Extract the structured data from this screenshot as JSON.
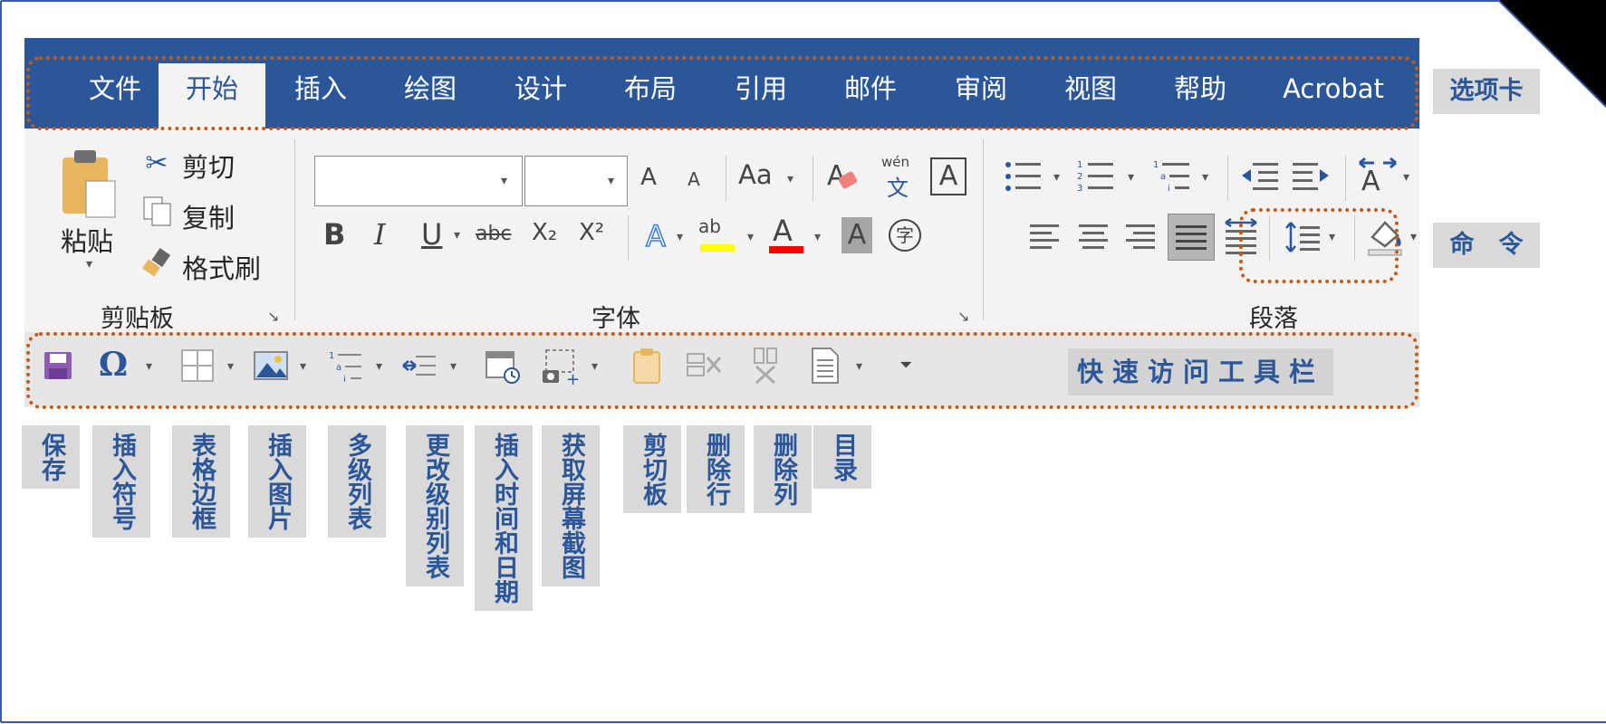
{
  "tabs": [
    {
      "label": "文件"
    },
    {
      "label": "开始"
    },
    {
      "label": "插入"
    },
    {
      "label": "绘图"
    },
    {
      "label": "设计"
    },
    {
      "label": "布局"
    },
    {
      "label": "引用"
    },
    {
      "label": "邮件"
    },
    {
      "label": "审阅"
    },
    {
      "label": "视图"
    },
    {
      "label": "帮助"
    },
    {
      "label": "Acrobat"
    }
  ],
  "clipboard": {
    "paste": "粘贴",
    "cut": "剪切",
    "copy": "复制",
    "format_painter": "格式刷",
    "group": "剪贴板"
  },
  "font": {
    "group": "字体",
    "change_case": "Aa",
    "phonetic_top": "wén",
    "phonetic_bottom": "文",
    "bold": "B",
    "italic": "I",
    "underline": "U",
    "strike": "abc",
    "subscript": "X₂",
    "superscript": "X²",
    "highlight": "ab",
    "font_color": "A",
    "char_shading": "A",
    "enclosed": "字",
    "border_char": "A"
  },
  "paragraph": {
    "group": "段落"
  },
  "callouts": {
    "tabs": "选项卡",
    "commands": "命　令",
    "qat": "快速访问工具栏"
  },
  "qat_labels": [
    "保存",
    "插入符号",
    "表格边框",
    "插入图片",
    "多级列表",
    "更改级别列表",
    "插入时间和日期",
    "获取屏幕截图",
    "剪切板",
    "删除行",
    "删除列",
    "目录"
  ],
  "colors": {
    "tab_bar": "#2b579a",
    "ribbon_bg": "#f3f3f3",
    "dotted_outline": "#c55a11",
    "callout_bg": "#d9d9d9",
    "callout_text": "#2b579a"
  }
}
